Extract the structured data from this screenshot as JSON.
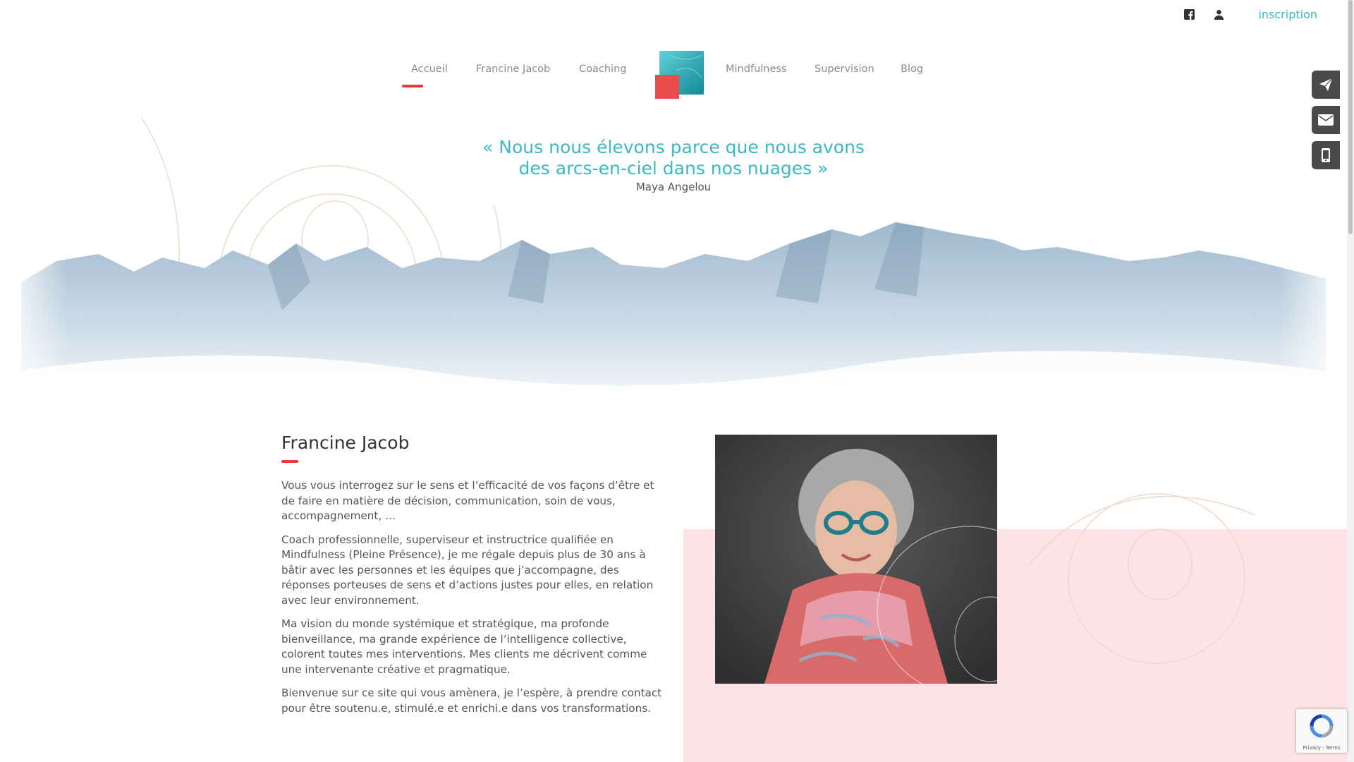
{
  "topbar": {
    "icons": [
      "facebook-icon",
      "user-icon"
    ],
    "inscription": "inscription"
  },
  "nav": {
    "items": [
      {
        "label": "Accueil",
        "active": true
      },
      {
        "label": "Francine Jacob"
      },
      {
        "label": "Coaching"
      },
      {
        "label": "Mindfulness"
      },
      {
        "label": "Supervision"
      },
      {
        "label": "Blog"
      }
    ],
    "logo_icon": "logo-squares-icon"
  },
  "quote": {
    "line1": "« Nous nous élevons parce que nous avons",
    "line2": "des arcs-en-ciel dans nos nuages »",
    "author": "Maya Angelou"
  },
  "bio": {
    "title": "Francine Jacob",
    "paragraphs": [
      "Vous vous interrogez sur le sens et l’efficacité de vos façons d’être et de faire en matière de décision, communication, soin de vous, accompagnement, …",
      "Coach professionnelle, superviseur et instructrice qualifiée en Mindfulness (Pleine Présence), je me régale depuis plus de 30 ans à bâtir avec les personnes et les équipes que j’accompagne, des réponses porteuses de sens et d’actions justes pour elles, en relation avec leur environnement.",
      "Ma vision du monde systémique et stratégique, ma profonde bienveillance, ma grande expérience de l’intelligence collective, colorent toutes mes interventions. Mes clients me décrivent comme une intervenante créative et pragmatique.",
      "Bienvenue sur ce site qui vous amènera, je l’espère, à prendre contact pour être soutenu.e, stimulé.e et enrichi.e dans vos transformations."
    ]
  },
  "side_buttons": [
    "paper-plane-icon",
    "envelope-icon",
    "mobile-phone-icon"
  ],
  "recaptcha": {
    "text": "Privacy - Terms"
  },
  "colors": {
    "accent_teal": "#3bb8c4",
    "accent_red": "#e53a3a",
    "pink_bg": "#fce3e6",
    "side_button_bg": "#4a4a4a"
  }
}
